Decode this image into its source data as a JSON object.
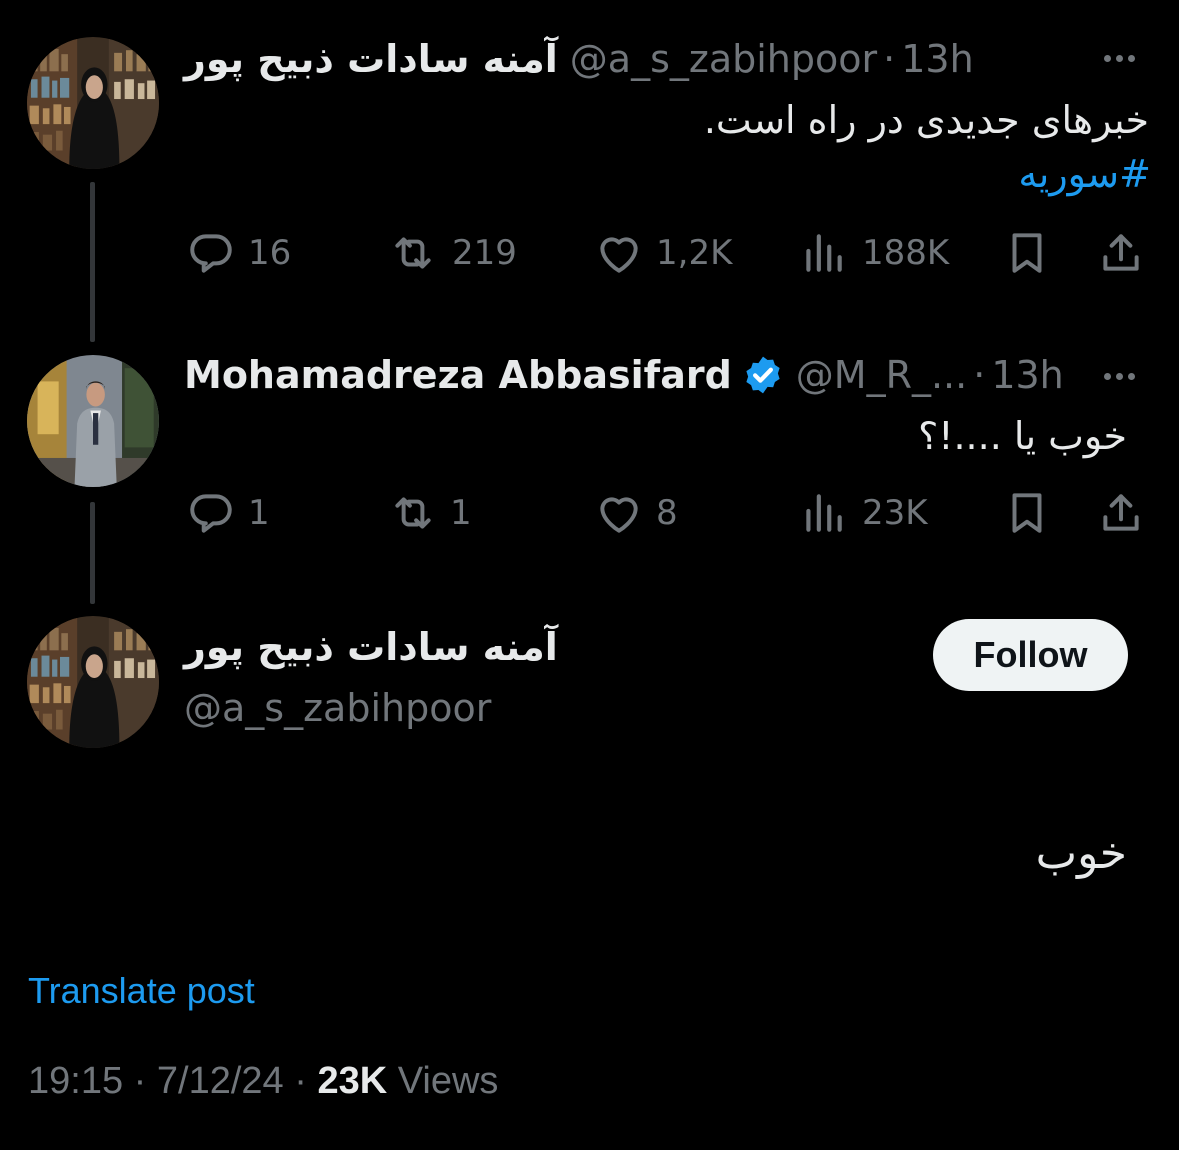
{
  "tweet1": {
    "name": "آمنه سادات ذبیح پور",
    "handle": "@a_s_zabihpoor",
    "separator": "·",
    "time": "13h",
    "text": "خبرهای جدیدی در راه است.",
    "hashtag": "#سوریه",
    "replies": "16",
    "reposts": "219",
    "likes": "1,2K",
    "views": "188K"
  },
  "tweet2": {
    "name": "Mohamadreza Abbasifard",
    "verified": true,
    "handle": "@M_R_...",
    "separator": "·",
    "time": "13h",
    "text": "خوب یا ....!؟",
    "replies": "1",
    "reposts": "1",
    "likes": "8",
    "views": "23K"
  },
  "main": {
    "name": "آمنه سادات ذبیح پور",
    "handle": "@a_s_zabihpoor",
    "follow_label": "Follow",
    "text": "خوب",
    "translate_label": "Translate post",
    "time": "19:15",
    "date": "7/12/24",
    "separator": "·",
    "views_count": "23K",
    "views_label": "Views"
  },
  "colors": {
    "background": "#000000",
    "text": "#e7e9ea",
    "muted": "#71767b",
    "accent": "#1d9bf0",
    "button_bg": "#eff3f4"
  },
  "icons": [
    "reply-icon",
    "repost-icon",
    "like-icon",
    "views-icon",
    "bookmark-icon",
    "share-icon",
    "verified-icon",
    "more-icon"
  ]
}
